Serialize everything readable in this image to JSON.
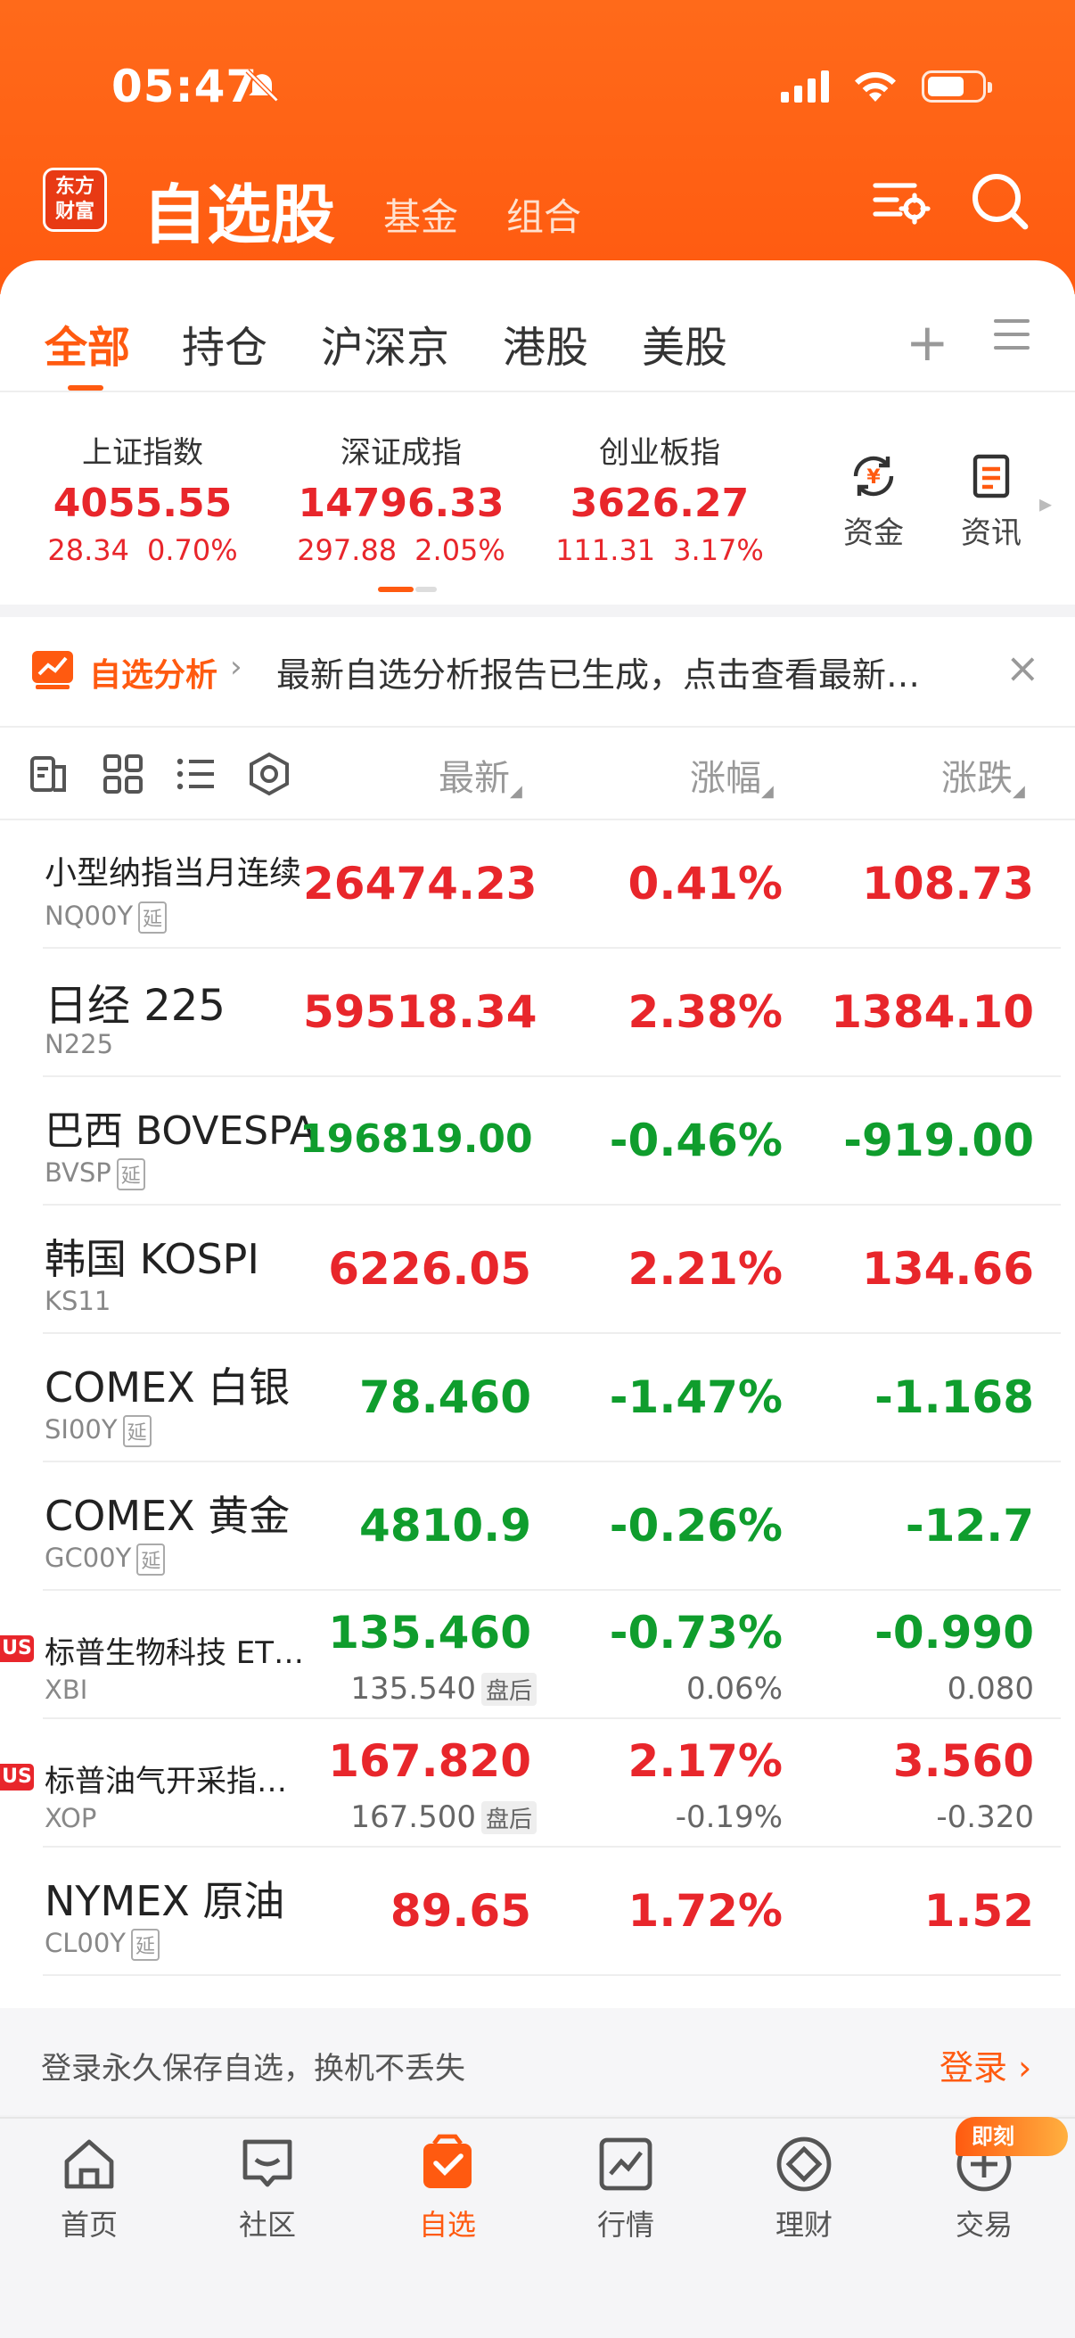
{
  "status_bar": {
    "time": "05:47"
  },
  "header": {
    "logo_line1": "东方",
    "logo_line2": "财富",
    "title": "自选股",
    "sub_tab_1": "基金",
    "sub_tab_2": "组合"
  },
  "tabs": [
    {
      "label": "全部",
      "active": true
    },
    {
      "label": "持仓"
    },
    {
      "label": "沪深京"
    },
    {
      "label": "港股"
    },
    {
      "label": "美股"
    }
  ],
  "tab_actions": {
    "add": "+"
  },
  "indices": [
    {
      "name": "上证指数",
      "value": "4055.55",
      "change": "28.34",
      "pct": "0.70%"
    },
    {
      "name": "深证成指",
      "value": "14796.33",
      "change": "297.88",
      "pct": "2.05%"
    },
    {
      "name": "创业板指",
      "value": "3626.27",
      "change": "111.31",
      "pct": "3.17%"
    }
  ],
  "quick_links": [
    {
      "label": "资金",
      "icon": "yuan-flow-icon"
    },
    {
      "label": "资讯",
      "icon": "news-doc-icon"
    }
  ],
  "banner": {
    "tag": "自选分析",
    "text": "最新自选分析报告已生成，点击查看最新…"
  },
  "columns": {
    "latest": "最新",
    "change_pct": "涨幅",
    "change_amt": "涨跌"
  },
  "rows": [
    {
      "name": "小型纳指当月连续",
      "code": "NQ00Y",
      "tag": "延",
      "latest": "26474.23",
      "pct": "0.41%",
      "chg": "108.73",
      "color": "red"
    },
    {
      "name": "日经 225",
      "code": "N225",
      "tag": "",
      "latest": "59518.34",
      "pct": "2.38%",
      "chg": "1384.10",
      "color": "red"
    },
    {
      "name": "巴西 BOVESPA",
      "code": "BVSP",
      "tag": "延",
      "latest": "196819.00",
      "pct": "-0.46%",
      "chg": "-919.00",
      "color": "green"
    },
    {
      "name": "韩国 KOSPI",
      "code": "KS11",
      "tag": "",
      "latest": "6226.05",
      "pct": "2.21%",
      "chg": "134.66",
      "color": "red"
    },
    {
      "name": "COMEX 白银",
      "code": "SI00Y",
      "tag": "延",
      "latest": "78.460",
      "pct": "-1.47%",
      "chg": "-1.168",
      "color": "green"
    },
    {
      "name": "COMEX 黄金",
      "code": "GC00Y",
      "tag": "延",
      "latest": "4810.9",
      "pct": "-0.26%",
      "chg": "-12.7",
      "color": "green"
    },
    {
      "name": "标普生物科技 ET…",
      "code": "XBI",
      "badge": "US",
      "latest": "135.460",
      "pct": "-0.73%",
      "chg": "-0.990",
      "color": "green",
      "after_price": "135.540",
      "after_tag": "盘后",
      "after_pct": "0.06%",
      "after_chg": "0.080"
    },
    {
      "name": "标普油气开采指…",
      "code": "XOP",
      "badge": "US",
      "latest": "167.820",
      "pct": "2.17%",
      "chg": "3.560",
      "color": "red",
      "after_price": "167.500",
      "after_tag": "盘后",
      "after_pct": "-0.19%",
      "after_chg": "-0.320"
    },
    {
      "name": "NYMEX 原油",
      "code": "CL00Y",
      "tag": "延",
      "latest": "89.65",
      "pct": "1.72%",
      "chg": "1.52",
      "color": "red"
    }
  ],
  "login_bar": {
    "text": "登录永久保存自选，换机不丢失",
    "button": "登录"
  },
  "tab_bar": [
    {
      "label": "首页"
    },
    {
      "label": "社区"
    },
    {
      "label": "自选",
      "active": true
    },
    {
      "label": "行情"
    },
    {
      "label": "理财"
    },
    {
      "label": "交易"
    }
  ],
  "trade_badge": "即刻",
  "colors": {
    "brand": "#ff5a10",
    "up": "#e8262b",
    "down": "#0f9d2d"
  }
}
